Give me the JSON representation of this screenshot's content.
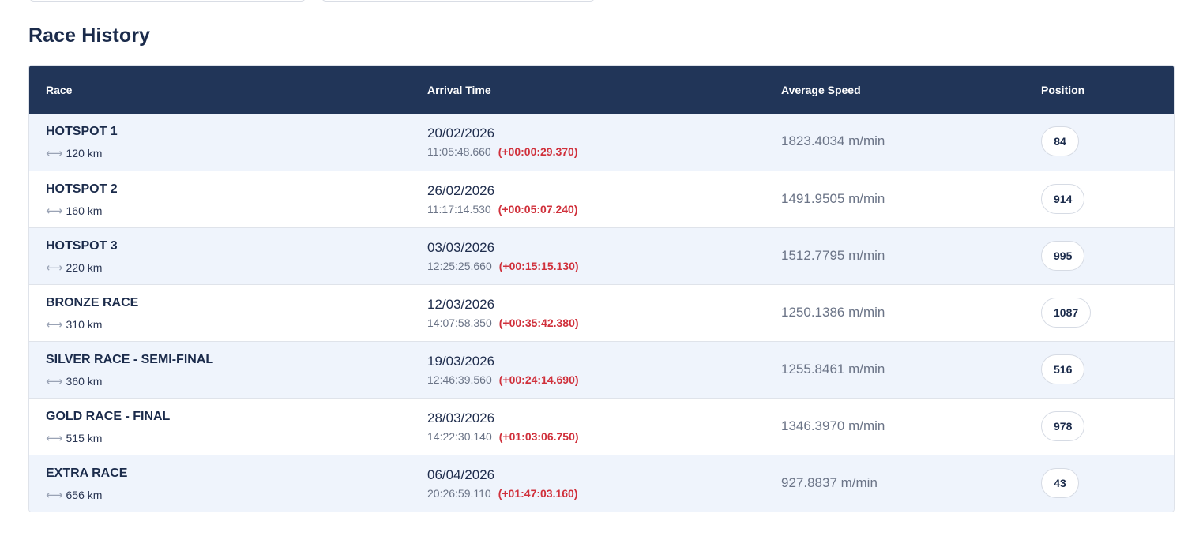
{
  "section": {
    "title": "Race History"
  },
  "table": {
    "headers": {
      "race": "Race",
      "arrival": "Arrival Time",
      "speed": "Average Speed",
      "position": "Position"
    },
    "rows": [
      {
        "name": "HOTSPOT 1",
        "distance": "120 km",
        "date": "20/02/2026",
        "time": "11:05:48.660",
        "delta": "(+00:00:29.370)",
        "speed": "1823.4034 m/min",
        "position": "84"
      },
      {
        "name": "HOTSPOT 2",
        "distance": "160 km",
        "date": "26/02/2026",
        "time": "11:17:14.530",
        "delta": "(+00:05:07.240)",
        "speed": "1491.9505 m/min",
        "position": "914"
      },
      {
        "name": "HOTSPOT 3",
        "distance": "220 km",
        "date": "03/03/2026",
        "time": "12:25:25.660",
        "delta": "(+00:15:15.130)",
        "speed": "1512.7795 m/min",
        "position": "995"
      },
      {
        "name": "BRONZE RACE",
        "distance": "310 km",
        "date": "12/03/2026",
        "time": "14:07:58.350",
        "delta": "(+00:35:42.380)",
        "speed": "1250.1386 m/min",
        "position": "1087"
      },
      {
        "name": "SILVER RACE - SEMI-FINAL",
        "distance": "360 km",
        "date": "19/03/2026",
        "time": "12:46:39.560",
        "delta": "(+00:24:14.690)",
        "speed": "1255.8461 m/min",
        "position": "516"
      },
      {
        "name": "GOLD RACE - FINAL",
        "distance": "515 km",
        "date": "28/03/2026",
        "time": "14:22:30.140",
        "delta": "(+01:03:06.750)",
        "speed": "1346.3970 m/min",
        "position": "978"
      },
      {
        "name": "EXTRA RACE",
        "distance": "656 km",
        "date": "06/04/2026",
        "time": "20:26:59.110",
        "delta": "(+01:47:03.160)",
        "speed": "927.8837 m/min",
        "position": "43"
      }
    ]
  },
  "colors": {
    "header_bg": "#213558",
    "row_alt_bg": "#eff4fc",
    "delta_red": "#d0303b"
  },
  "icons": {
    "distance": "double-arrow-icon"
  }
}
